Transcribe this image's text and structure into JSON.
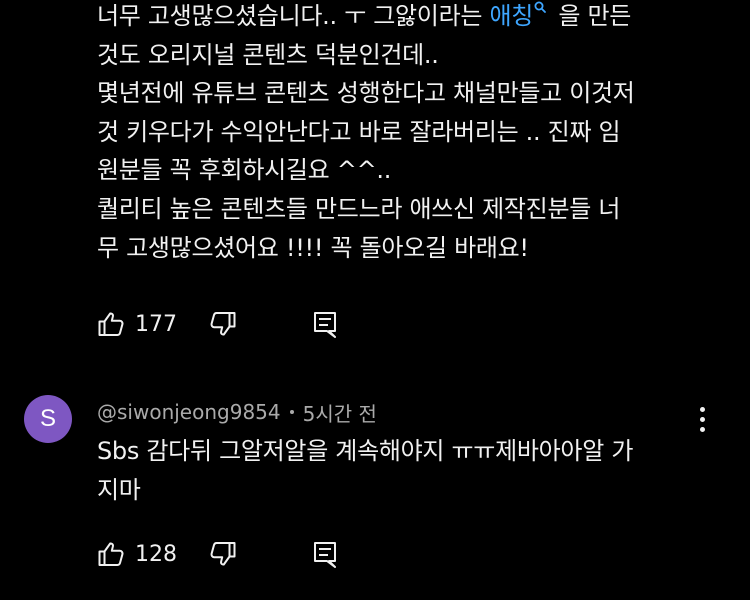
{
  "comments": [
    {
      "text_lines": [
        "너무 고생많으셨습니다.. ㅜ 그앓이라는 ",
        "것도 오리지널 콘텐츠 덕분인건데..",
        "몇년전에 유튜브 콘텐츠 성행한다고 채널만들고 이것저",
        "것 키우다가 수익안난다고 바로 잘라버리는 .. 진짜 임",
        "원분들 꼭 후회하시길요 ^^..",
        "퀄리티 높은 콘텐츠들 만드느라 애쓰신 제작진분들 너",
        "무 고생많으셨어요 !!!! 꼭 돌아오길 바래요!"
      ],
      "search_link": "애칭",
      "line1_tail": " 을 만든",
      "like_count": "177"
    },
    {
      "avatar_letter": "S",
      "avatar_color": "#7e57c2",
      "author": "@siwonjeong9854",
      "time": "5시간 전",
      "text_lines": [
        "Sbs 감다뒤 그알저알을 계속해야지 ㅠㅠ제바아아알 가",
        "지마"
      ],
      "like_count": "128"
    }
  ],
  "icons": {
    "like": "thumbs-up-icon",
    "dislike": "thumbs-down-icon",
    "reply": "reply-comment-icon",
    "more": "more-vertical-icon",
    "search": "search-icon"
  },
  "colors": {
    "background": "#000000",
    "text": "#f1f1f1",
    "secondary_text": "#aaaaaa",
    "link": "#3ea6ff"
  }
}
